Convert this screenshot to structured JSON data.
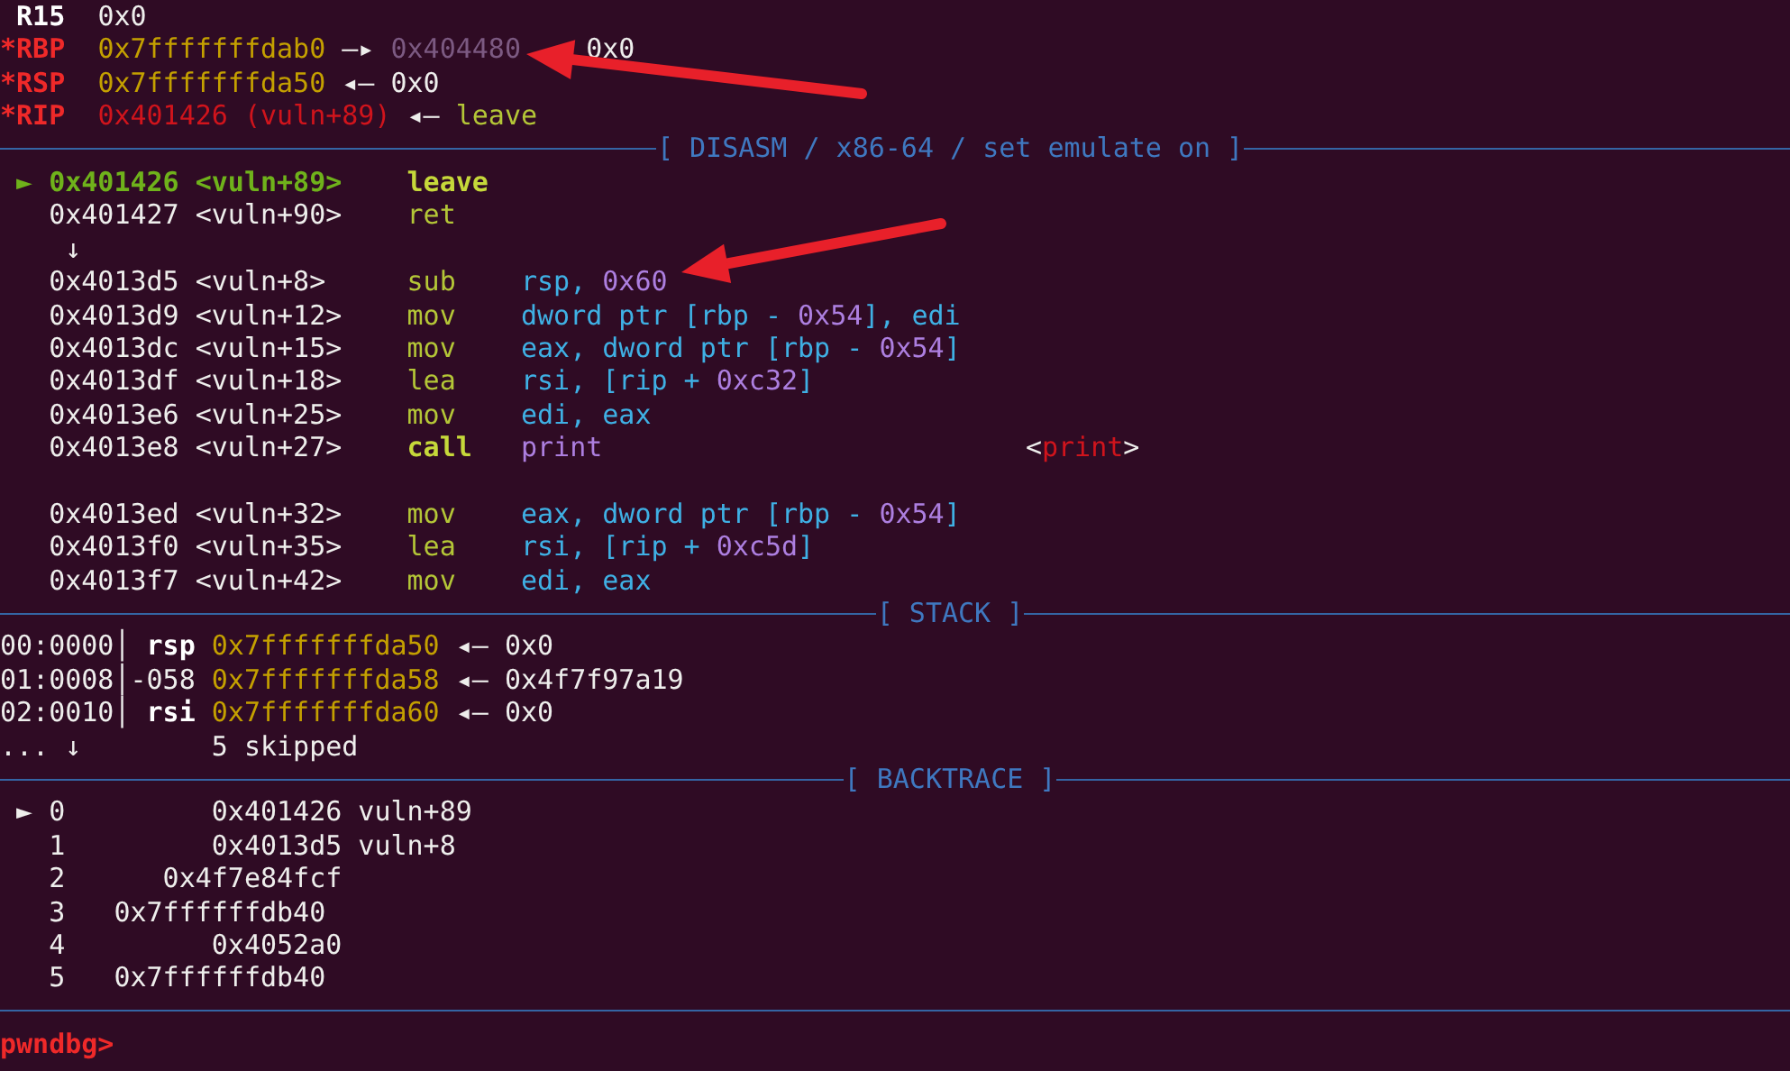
{
  "lines": [
    {
      "kind": "text",
      "segments": [
        {
          "text": " R15  ",
          "kind": "label"
        },
        {
          "text": "0x0",
          "kind": "plain"
        }
      ]
    },
    {
      "kind": "text",
      "segments": [
        {
          "text": "*RBP  ",
          "kind": "changed"
        },
        {
          "text": "0x7fffffffdab0",
          "kind": "stack"
        },
        {
          "text": " —▸ ",
          "kind": "plain"
        },
        {
          "text": "0x404480",
          "kind": "data"
        },
        {
          "text": "    0x0",
          "kind": "plain"
        }
      ]
    },
    {
      "kind": "text",
      "segments": [
        {
          "text": "*RSP  ",
          "kind": "changed"
        },
        {
          "text": "0x7fffffffda50",
          "kind": "stack"
        },
        {
          "text": " ◂— 0x0",
          "kind": "plain"
        }
      ]
    },
    {
      "kind": "text",
      "segments": [
        {
          "text": "*RIP  ",
          "kind": "changed"
        },
        {
          "text": "0x401426 (vuln+89)",
          "kind": "code"
        },
        {
          "text": " ◂— ",
          "kind": "plain"
        },
        {
          "text": "leave",
          "kind": "mnemonic"
        }
      ]
    },
    {
      "kind": "rule",
      "title": "[ DISASM / x86-64 / set emulate on ]"
    },
    {
      "kind": "text",
      "segments": [
        {
          "text": " ► ",
          "kind": "current"
        },
        {
          "text": "0x401426 <vuln+89>    ",
          "kind": "current"
        },
        {
          "text": "leave",
          "kind": "mnemonic-bold"
        }
      ]
    },
    {
      "kind": "text",
      "segments": [
        {
          "text": "   0x401427 <vuln+90>    ",
          "kind": "plain"
        },
        {
          "text": "ret",
          "kind": "mnemonic"
        }
      ]
    },
    {
      "kind": "text",
      "segments": [
        {
          "text": "    ↓",
          "kind": "plain"
        }
      ]
    },
    {
      "kind": "text",
      "segments": [
        {
          "text": "   0x4013d5 <vuln+8>     ",
          "kind": "plain"
        },
        {
          "text": "sub    ",
          "kind": "mnemonic"
        },
        {
          "text": "rsp, ",
          "kind": "operand"
        },
        {
          "text": "0x60",
          "kind": "number"
        }
      ]
    },
    {
      "kind": "text",
      "segments": [
        {
          "text": "   0x4013d9 <vuln+12>    ",
          "kind": "plain"
        },
        {
          "text": "mov    ",
          "kind": "mnemonic"
        },
        {
          "text": "dword ptr [rbp - ",
          "kind": "operand"
        },
        {
          "text": "0x54",
          "kind": "number"
        },
        {
          "text": "], edi",
          "kind": "operand"
        }
      ]
    },
    {
      "kind": "text",
      "segments": [
        {
          "text": "   0x4013dc <vuln+15>    ",
          "kind": "plain"
        },
        {
          "text": "mov    ",
          "kind": "mnemonic"
        },
        {
          "text": "eax, dword ptr [rbp - ",
          "kind": "operand"
        },
        {
          "text": "0x54",
          "kind": "number"
        },
        {
          "text": "]",
          "kind": "operand"
        }
      ]
    },
    {
      "kind": "text",
      "segments": [
        {
          "text": "   0x4013df <vuln+18>    ",
          "kind": "plain"
        },
        {
          "text": "lea    ",
          "kind": "mnemonic"
        },
        {
          "text": "rsi, [rip + ",
          "kind": "operand"
        },
        {
          "text": "0xc32",
          "kind": "number"
        },
        {
          "text": "]",
          "kind": "operand"
        }
      ]
    },
    {
      "kind": "text",
      "segments": [
        {
          "text": "   0x4013e6 <vuln+25>    ",
          "kind": "plain"
        },
        {
          "text": "mov    ",
          "kind": "mnemonic"
        },
        {
          "text": "edi, eax",
          "kind": "operand"
        }
      ]
    },
    {
      "kind": "text",
      "segments": [
        {
          "text": "   0x4013e8 <vuln+27>    ",
          "kind": "plain"
        },
        {
          "text": "call   ",
          "kind": "mnemonic-bold"
        },
        {
          "text": "print",
          "kind": "number"
        },
        {
          "text": "                          <",
          "kind": "plain"
        },
        {
          "text": "print",
          "kind": "code"
        },
        {
          "text": ">",
          "kind": "plain"
        }
      ]
    },
    {
      "kind": "blank"
    },
    {
      "kind": "text",
      "segments": [
        {
          "text": "   0x4013ed <vuln+32>    ",
          "kind": "plain"
        },
        {
          "text": "mov    ",
          "kind": "mnemonic"
        },
        {
          "text": "eax, dword ptr [rbp - ",
          "kind": "operand"
        },
        {
          "text": "0x54",
          "kind": "number"
        },
        {
          "text": "]",
          "kind": "operand"
        }
      ]
    },
    {
      "kind": "text",
      "segments": [
        {
          "text": "   0x4013f0 <vuln+35>    ",
          "kind": "plain"
        },
        {
          "text": "lea    ",
          "kind": "mnemonic"
        },
        {
          "text": "rsi, [rip + ",
          "kind": "operand"
        },
        {
          "text": "0xc5d",
          "kind": "number"
        },
        {
          "text": "]",
          "kind": "operand"
        }
      ]
    },
    {
      "kind": "text",
      "segments": [
        {
          "text": "   0x4013f7 <vuln+42>    ",
          "kind": "plain"
        },
        {
          "text": "mov    ",
          "kind": "mnemonic"
        },
        {
          "text": "edi, eax",
          "kind": "operand"
        }
      ]
    },
    {
      "kind": "rule",
      "title": "[ STACK ]"
    },
    {
      "kind": "text",
      "segments": [
        {
          "text": "00:0000│ ",
          "kind": "plain"
        },
        {
          "text": "rsp ",
          "kind": "label"
        },
        {
          "text": "0x7fffffffda50",
          "kind": "stack"
        },
        {
          "text": " ◂— 0x0",
          "kind": "plain"
        }
      ]
    },
    {
      "kind": "text",
      "segments": [
        {
          "text": "01:0008│-058 ",
          "kind": "plain"
        },
        {
          "text": "0x7fffffffda58",
          "kind": "stack"
        },
        {
          "text": " ◂— 0x4f7f97a19",
          "kind": "plain"
        }
      ]
    },
    {
      "kind": "text",
      "segments": [
        {
          "text": "02:0010│ ",
          "kind": "plain"
        },
        {
          "text": "rsi ",
          "kind": "label"
        },
        {
          "text": "0x7fffffffda60",
          "kind": "stack"
        },
        {
          "text": " ◂— 0x0",
          "kind": "plain"
        }
      ]
    },
    {
      "kind": "text",
      "segments": [
        {
          "text": "... ↓        5 skipped",
          "kind": "plain"
        }
      ]
    },
    {
      "kind": "rule",
      "title": "[ BACKTRACE ]"
    },
    {
      "kind": "text",
      "segments": [
        {
          "text": " ► 0         0x401426 vuln+89",
          "kind": "plain"
        }
      ]
    },
    {
      "kind": "text",
      "segments": [
        {
          "text": "   1         0x4013d5 vuln+8",
          "kind": "plain"
        }
      ]
    },
    {
      "kind": "text",
      "segments": [
        {
          "text": "   2      0x4f7e84fcf",
          "kind": "plain"
        }
      ]
    },
    {
      "kind": "text",
      "segments": [
        {
          "text": "   3   0x7ffffffdb40",
          "kind": "plain"
        }
      ]
    },
    {
      "kind": "text",
      "segments": [
        {
          "text": "   4         0x4052a0",
          "kind": "plain"
        }
      ]
    },
    {
      "kind": "text",
      "segments": [
        {
          "text": "   5   0x7ffffffdb40",
          "kind": "plain"
        }
      ]
    },
    {
      "kind": "rule"
    },
    {
      "kind": "text",
      "segments": [
        {
          "text": "pwndbg> ",
          "kind": "prompt"
        }
      ]
    }
  ]
}
